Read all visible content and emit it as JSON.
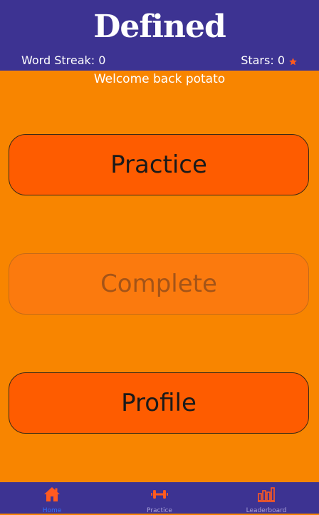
{
  "header": {
    "app_title": "Defined",
    "word_streak": "Word Streak: 0",
    "stars": "Stars: 0",
    "star_icon": "star-icon"
  },
  "welcome": "Welcome back potato",
  "menu": {
    "practice_label": "Practice",
    "complete_label": "Complete",
    "profile_label": "Profile"
  },
  "nav": {
    "home_label": "Home",
    "practice_label": "Practice",
    "leaderboard_label": "Leaderboard"
  },
  "colors": {
    "header_bg": "#3d3392",
    "page_bg": "#f88500",
    "button_bg": "#fe5c00",
    "button_disabled_bg": "#fb7a0e",
    "nav_active": "#2f73ff",
    "accent_icon": "#ff5a1f"
  }
}
